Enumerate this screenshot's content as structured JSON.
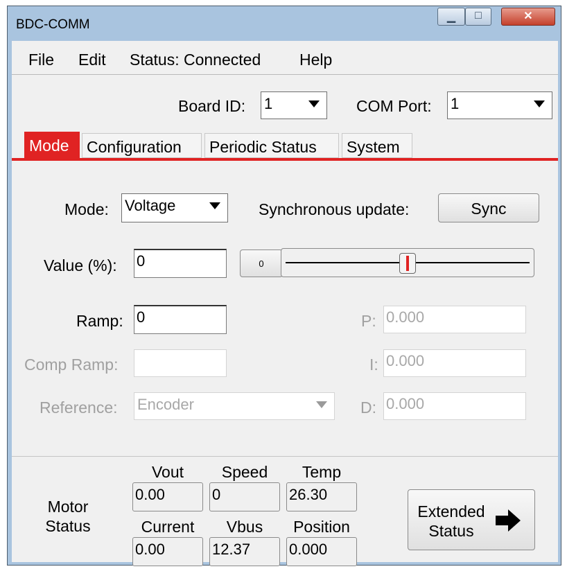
{
  "window": {
    "title": "BDC-COMM"
  },
  "menu": [
    "File",
    "Edit",
    "Status: Connected",
    "Help"
  ],
  "board_id": {
    "label": "Board ID:",
    "value": "1"
  },
  "com_port": {
    "label": "COM Port:",
    "value": "1"
  },
  "tabs": [
    "Mode",
    "Configuration",
    "Periodic Status",
    "System"
  ],
  "active_tab": "Mode",
  "mode_panel": {
    "mode_label": "Mode:",
    "mode_value": "Voltage",
    "sync_label": "Synchronous update:",
    "sync_button": "Sync",
    "value_label": "Value (%):",
    "value": "0",
    "slider_value_label": "0",
    "slider_fraction": 0.5,
    "ramp_label": "Ramp:",
    "ramp_value": "0",
    "comp_ramp_label": "Comp Ramp:",
    "comp_ramp_value": "",
    "reference_label": "Reference:",
    "reference_value": "Encoder",
    "p_label": "P:",
    "p_value": "0.000",
    "i_label": "I:",
    "i_value": "0.000",
    "d_label": "D:",
    "d_value": "0.000"
  },
  "motor_status": {
    "label_line1": "Motor",
    "label_line2": "Status",
    "headers": [
      "Vout",
      "Speed",
      "Temp",
      "Current",
      "Vbus",
      "Position"
    ],
    "values": [
      "0.00",
      "0",
      "26.30",
      "0.00",
      "12.37",
      "0.000"
    ],
    "extended_line1": "Extended",
    "extended_line2": "Status"
  },
  "colors": {
    "accent": "#e02323",
    "disabled_text": "#a0a0a0"
  }
}
